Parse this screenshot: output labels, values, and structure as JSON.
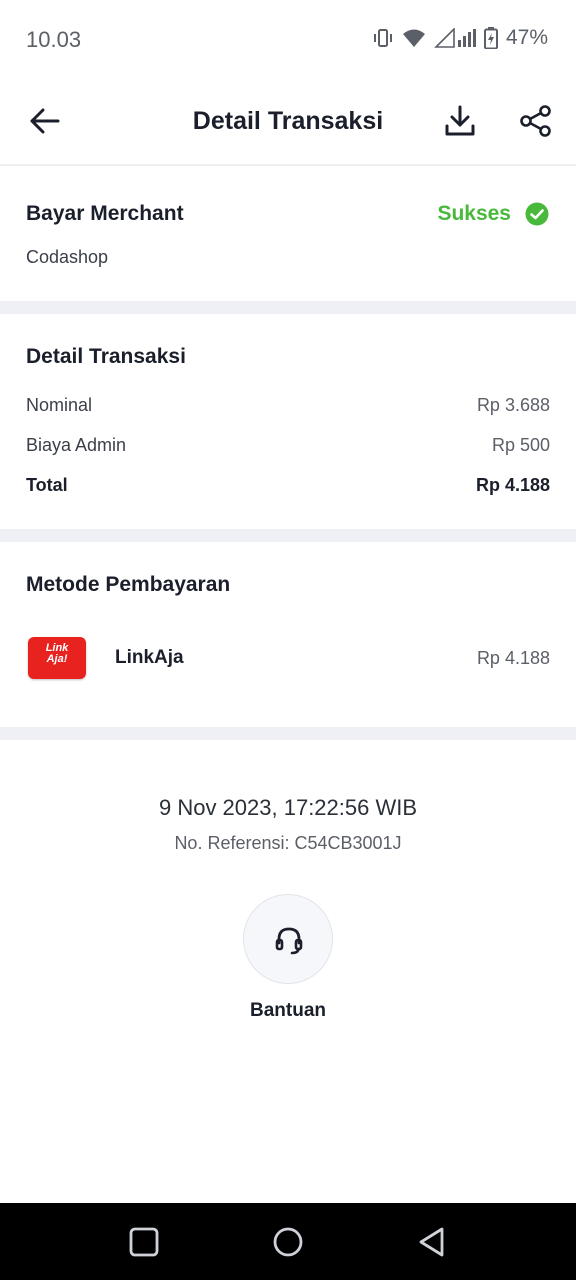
{
  "status_bar": {
    "time": "10.03",
    "battery": "47%",
    "icons": [
      "vibrate-icon",
      "wifi-icon",
      "signal-icon",
      "battery-charging-icon"
    ]
  },
  "header": {
    "title": "Detail Transaksi",
    "icons": [
      "back-arrow-icon",
      "download-icon",
      "share-icon"
    ]
  },
  "merchant": {
    "title": "Bayar Merchant",
    "name": "Codashop",
    "status": "Sukses",
    "status_color": "#49b93c"
  },
  "details": {
    "title": "Detail Transaksi",
    "rows": [
      {
        "label": "Nominal",
        "value": "Rp 3.688"
      },
      {
        "label": "Biaya Admin",
        "value": "Rp 500"
      },
      {
        "label": "Total",
        "value": "Rp 4.188"
      }
    ]
  },
  "payment": {
    "title": "Metode Pembayaran",
    "logo_text_line1": "Link",
    "logo_text_line2": "Aja!",
    "logo_color": "#e8221f",
    "method": "LinkAja",
    "amount": "Rp 4.188"
  },
  "footer": {
    "datetime": "9 Nov 2023, 17:22:56 WIB",
    "reference": "No. Referensi: C54CB3001J",
    "help_label": "Bantuan",
    "help_icon": "headset-icon"
  },
  "nav": {
    "icons": [
      "recent-apps-icon",
      "home-icon",
      "back-icon"
    ]
  }
}
